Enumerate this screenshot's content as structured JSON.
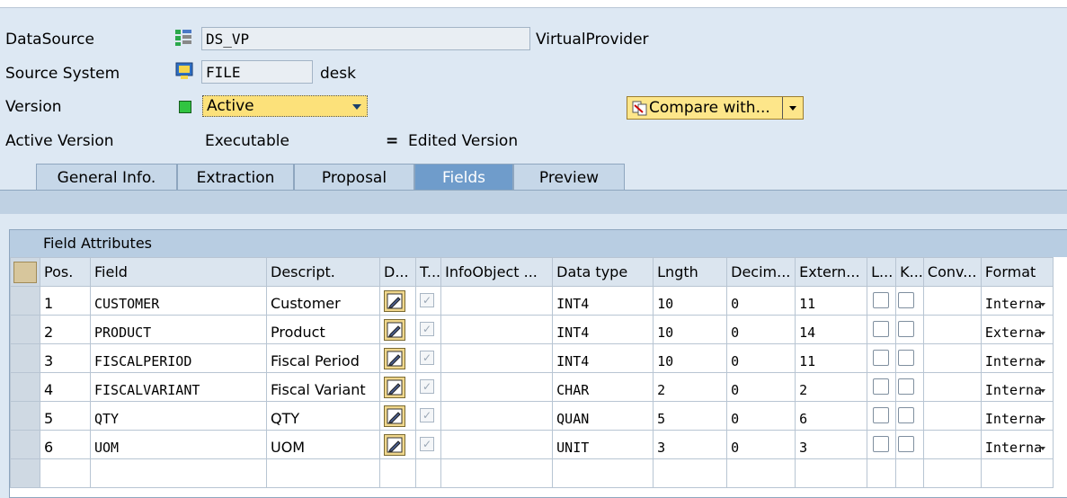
{
  "header": {
    "datasource": {
      "label": "DataSource",
      "value": "DS_VP",
      "type_text": "VirtualProvider"
    },
    "source_system": {
      "label": "Source System",
      "value": "FILE",
      "desc": "desk"
    },
    "version": {
      "label": "Version",
      "selected": "Active"
    },
    "compare_button": "Compare with...",
    "active_version": {
      "label": "Active Version",
      "value": "Executable",
      "equals": "=",
      "edited": "Edited Version"
    }
  },
  "tabs": [
    {
      "label": "General Info.",
      "active": false
    },
    {
      "label": "Extraction",
      "active": false
    },
    {
      "label": "Proposal",
      "active": false
    },
    {
      "label": "Fields",
      "active": true
    },
    {
      "label": "Preview",
      "active": false
    }
  ],
  "grid": {
    "title": "Field Attributes",
    "columns": [
      "Pos.",
      "Field",
      "Descript.",
      "D...",
      "T...",
      "InfoObject ...",
      "Data type",
      "Lngth",
      "Decim...",
      "Extern...",
      "L...",
      "K...",
      "Conv...",
      "Format"
    ],
    "rows": [
      {
        "pos": "1",
        "field": "CUSTOMER",
        "desc": "Customer",
        "dtype": "INT4",
        "len": "10",
        "dec": "0",
        "ext": "11",
        "format": "Interna"
      },
      {
        "pos": "2",
        "field": "PRODUCT",
        "desc": "Product",
        "dtype": "INT4",
        "len": "10",
        "dec": "0",
        "ext": "14",
        "format": "Externa"
      },
      {
        "pos": "3",
        "field": "FISCALPERIOD",
        "desc": "Fiscal Period",
        "dtype": "INT4",
        "len": "10",
        "dec": "0",
        "ext": "11",
        "format": "Interna"
      },
      {
        "pos": "4",
        "field": "FISCALVARIANT",
        "desc": "Fiscal Variant",
        "dtype": "CHAR",
        "len": "2",
        "dec": "0",
        "ext": "2",
        "format": "Interna"
      },
      {
        "pos": "5",
        "field": "QTY",
        "desc": "QTY",
        "dtype": "QUAN",
        "len": "5",
        "dec": "0",
        "ext": "6",
        "format": "Interna"
      },
      {
        "pos": "6",
        "field": "UOM",
        "desc": "UOM",
        "dtype": "UNIT",
        "len": "3",
        "dec": "0",
        "ext": "3",
        "format": "Interna"
      }
    ]
  },
  "colors": {
    "background": "#dde8f3",
    "active_tab": "#6f9ccb",
    "dropdown": "#fce17a"
  }
}
